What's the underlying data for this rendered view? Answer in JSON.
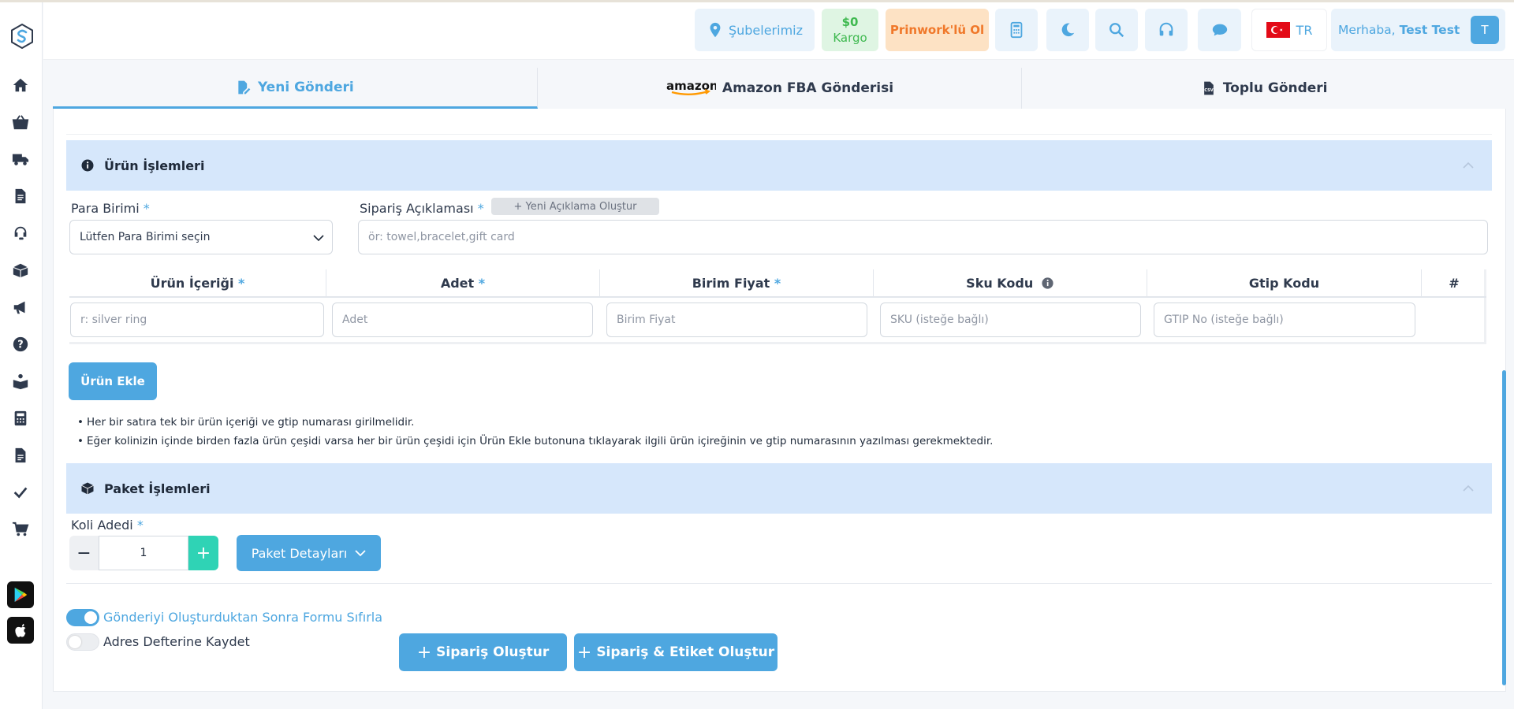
{
  "header": {
    "branches": "Şubelerimiz",
    "balance_amount": "$0",
    "balance_label": "Kargo",
    "prinwork": "Prinwork'lü Ol",
    "language": "TR",
    "greeting": "Merhaba,",
    "user_name": "Test Test",
    "avatar_letter": "T"
  },
  "tabs": [
    {
      "label": "Yeni Gönderi",
      "active": true
    },
    {
      "label": "Amazon FBA Gönderisi",
      "logo": "amazon"
    },
    {
      "label": "Toplu Gönderi"
    }
  ],
  "product_section": {
    "title": "Ürün İşlemleri",
    "currency_label": "Para Birimi",
    "currency_value": "Lütfen Para Birimi seçin",
    "order_desc_label": "Sipariş Açıklaması",
    "new_desc_button": "+ Yeni Açıklama Oluştur",
    "order_desc_placeholder": "ör: towel,bracelet,gift card",
    "columns": [
      "Ürün İçeriği",
      "Adet",
      "Birim Fiyat",
      "Sku Kodu",
      "Gtip Kodu",
      "#"
    ],
    "row_placeholders": [
      "r: silver ring",
      "Adet",
      "Birim Fiyat",
      "SKU (isteğe bağlı)",
      "GTIP No (isteğe bağlı)"
    ],
    "add_product_button": "Ürün Ekle",
    "notes": [
      "Her bir satıra tek bir ürün içeriği ve gtip numarası girilmelidir.",
      "Eğer kolinizin içinde birden fazla ürün çeşidi varsa her bir ürün çeşidi için Ürün Ekle butonuna tıklayarak ilgili ürün içireğinin ve gtip numarasının yazılması gerekmektedir."
    ]
  },
  "package_section": {
    "title": "Paket İşlemleri",
    "box_count_label": "Koli Adedi",
    "box_count_value": "1",
    "package_details_button": "Paket Detayları"
  },
  "options": {
    "reset_form_label": "Gönderiyi Oluşturduktan Sonra Formu Sıfırla",
    "reset_form_on": true,
    "save_address_label": "Adres Defterine Kaydet",
    "save_address_on": false
  },
  "actions": {
    "create_order": "Sipariş Oluştur",
    "create_order_label": "Sipariş & Etiket Oluştur"
  },
  "colors": {
    "accent": "#4ea7e0",
    "balance_bg": "#dff5e3",
    "balance_text": "#3fb950",
    "prinwork_bg": "#fde2c4",
    "prinwork_text": "#f0782a",
    "section_bg": "#d6e7fb",
    "plus_green": "#2fd3b5"
  }
}
